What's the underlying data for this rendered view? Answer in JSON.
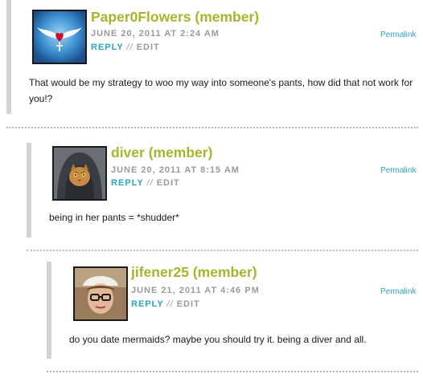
{
  "comments": [
    {
      "author": "Paper0Flowers (member)",
      "date": "JUNE 20, 2011 AT 2:24 AM",
      "reply": "REPLY",
      "separator": "//",
      "edit": "EDIT",
      "permalink": "Permalink",
      "text": "That would be my strategy to woo my way into someone's pants, how did that not work for you!?"
    },
    {
      "author": "diver (member)",
      "date": "JUNE 20, 2011 AT 8:15 AM",
      "reply": "REPLY",
      "separator": "//",
      "edit": "EDIT",
      "permalink": "Permalink",
      "text": "being in her pants = *shudder*"
    },
    {
      "author": "jifener25 (member)",
      "date": "JUNE 21, 2011 AT 4:46 PM",
      "reply": "REPLY",
      "separator": "//",
      "edit": "EDIT",
      "permalink": "Permalink",
      "text": "do you date mermaids? maybe you should try it. being a diver and all."
    }
  ]
}
